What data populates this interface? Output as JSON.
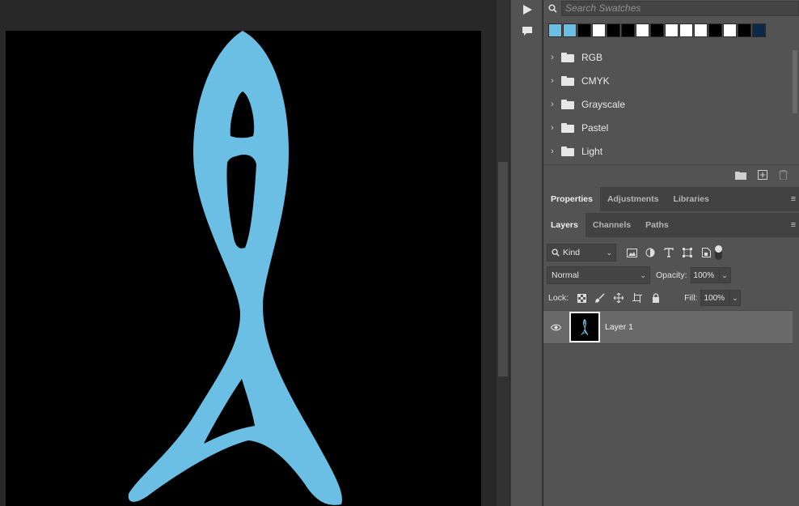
{
  "swatches": {
    "search_placeholder": "Search Swatches",
    "recent_colors": [
      "#6cbfe4",
      "#6cbfe4",
      "#000000",
      "#ffffff",
      "#000000",
      "#000000",
      "#ffffff",
      "#000000",
      "#ffffff",
      "#ffffff",
      "#ffffff",
      "#000000",
      "#ffffff",
      "#000000",
      "#0b2a4a"
    ],
    "groups": [
      {
        "label": "RGB"
      },
      {
        "label": "CMYK"
      },
      {
        "label": "Grayscale"
      },
      {
        "label": "Pastel"
      },
      {
        "label": "Light"
      }
    ]
  },
  "properties_tabs": [
    {
      "label": "Properties",
      "active": true
    },
    {
      "label": "Adjustments",
      "active": false
    },
    {
      "label": "Libraries",
      "active": false
    }
  ],
  "layers_tabs": [
    {
      "label": "Layers",
      "active": true
    },
    {
      "label": "Channels",
      "active": false
    },
    {
      "label": "Paths",
      "active": false
    }
  ],
  "layers": {
    "filter_kind": "Kind",
    "blend_mode": "Normal",
    "opacity_label": "Opacity:",
    "opacity_value": "100%",
    "lock_label": "Lock:",
    "fill_label": "Fill:",
    "fill_value": "100%",
    "items": [
      {
        "name": "Layer 1",
        "visible": true
      }
    ]
  },
  "colors": {
    "shape_fill": "#6cbfe4",
    "canvas_bg": "#000000",
    "panel_bg": "#535353",
    "app_bg": "#282828"
  }
}
